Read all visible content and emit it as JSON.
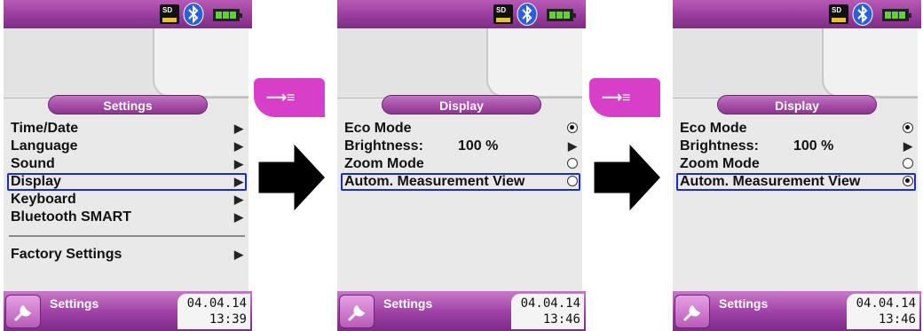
{
  "screens": [
    {
      "title": "Settings",
      "items": [
        {
          "label": "Time/Date"
        },
        {
          "label": "Language"
        },
        {
          "label": "Sound"
        },
        {
          "label": "Display"
        },
        {
          "label": "Keyboard"
        },
        {
          "label": "Bluetooth SMART"
        },
        {
          "label": "Factory Settings"
        }
      ],
      "bottom": {
        "title": "Settings",
        "date": "04.04.14",
        "time": "13:39"
      }
    },
    {
      "title": "Display",
      "items": [
        {
          "label": "Eco Mode"
        },
        {
          "label": "Brightness:",
          "value": "100 %"
        },
        {
          "label": "Zoom Mode"
        },
        {
          "label": "Autom. Measurement View"
        }
      ],
      "bottom": {
        "title": "Settings",
        "date": "04.04.14",
        "time": "13:46"
      }
    },
    {
      "title": "Display",
      "items": [
        {
          "label": "Eco Mode"
        },
        {
          "label": "Brightness:",
          "value": "100 %"
        },
        {
          "label": "Zoom Mode"
        },
        {
          "label": "Autom. Measurement View"
        }
      ],
      "bottom": {
        "title": "Settings",
        "date": "04.04.14",
        "time": "13:46"
      }
    }
  ],
  "status": {
    "sd_label": "SD",
    "battery_color": "#5fd13a"
  },
  "accent": {
    "purple": "#9b3fa0",
    "magenta": "#d83fc8",
    "selection": "#1d2fb3"
  },
  "icons": [
    "sd-card-icon",
    "bluetooth-icon",
    "battery-icon",
    "wrench-icon",
    "enter-key-icon",
    "arrow-right-icon"
  ]
}
